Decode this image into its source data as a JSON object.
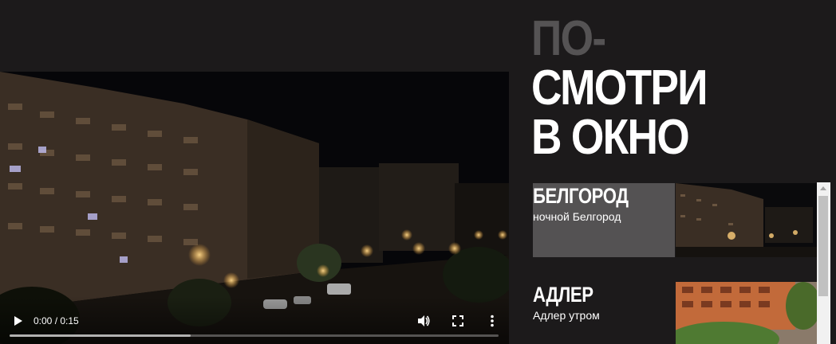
{
  "headline": {
    "line1": "ПО-",
    "line2": "СМОТРИ",
    "line3": "В ОКНО"
  },
  "player": {
    "time": "0:00 / 0:15",
    "buffered_fraction": 0.37,
    "icons": [
      "play-icon",
      "volume-icon",
      "fullscreen-icon",
      "more-options-icon"
    ]
  },
  "cities": [
    {
      "name": "БЕЛГОРОД",
      "subtitle": "ночной Белгород",
      "active": true
    },
    {
      "name": "АДЛЕР",
      "subtitle": "Адлер утром",
      "active": false
    }
  ],
  "colors": {
    "background": "#1c1a1b",
    "active_item": "#545253",
    "headline_muted": "#555354"
  }
}
